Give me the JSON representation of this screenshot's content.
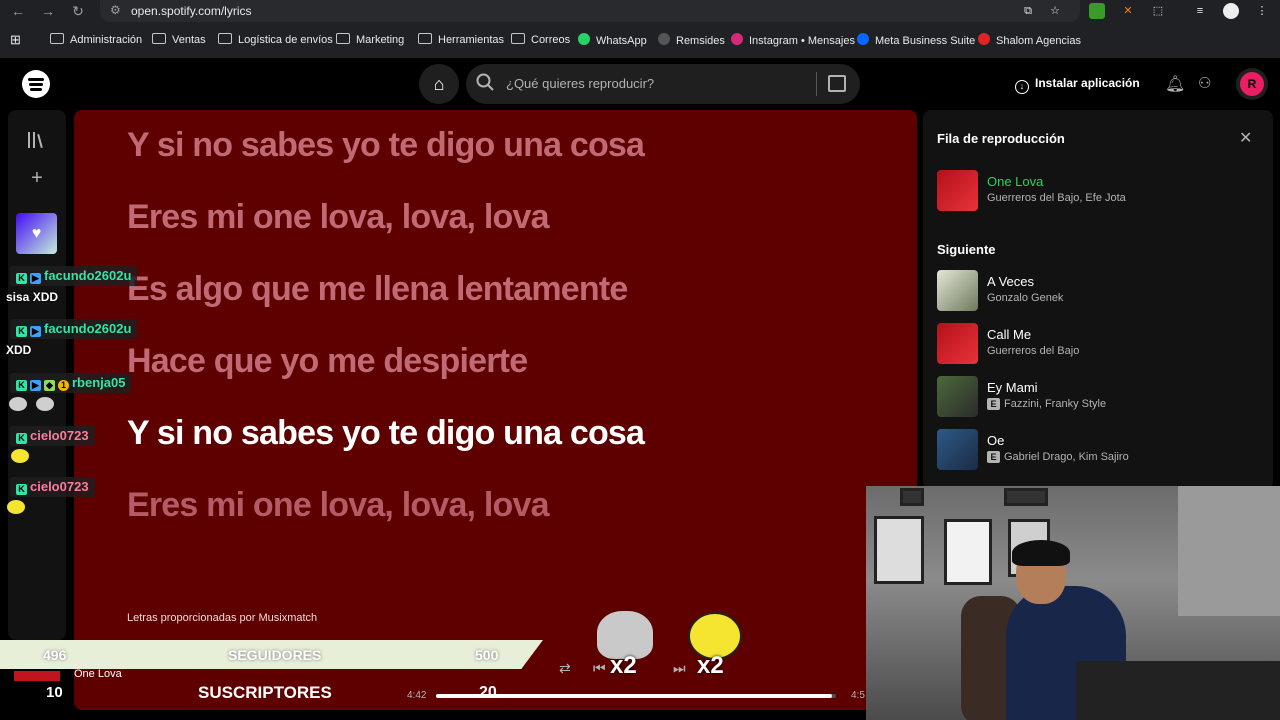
{
  "browser": {
    "url": "open.spotify.com/lyrics",
    "bookmarks": [
      "Administración",
      "Ventas",
      "Logística de envíos",
      "Marketing",
      "Herramientas",
      "Correos",
      "WhatsApp",
      "Remsides",
      "Instagram • Mensajes",
      "Meta Business Suite",
      "Shalom Agencias"
    ]
  },
  "header": {
    "search_placeholder": "¿Qué quieres reproducir?",
    "install_label": "Instalar aplicación",
    "avatar_initial": "R"
  },
  "lyrics": {
    "lines": [
      "Y si no sabes yo te digo una cosa",
      "Eres mi one lova, lova, lova",
      "Es algo que me llena lentamente",
      "Hace que yo me despierte",
      "Y si no sabes yo te digo una cosa",
      "Eres mi one lova, lova, lova"
    ],
    "active_index": 4,
    "credit": "Letras proporcionadas por Musixmatch"
  },
  "queue": {
    "title": "Fila de reproducción",
    "now_playing": {
      "title": "One Lova",
      "artist": "Guerreros del Bajo, Efe Jota"
    },
    "next_label": "Siguiente",
    "next": [
      {
        "title": "A Veces",
        "artist": "Gonzalo Genek",
        "explicit": false
      },
      {
        "title": "Call Me",
        "artist": "Guerreros del Bajo",
        "explicit": false
      },
      {
        "title": "Ey Mami",
        "artist": "Fazzini, Franky Style",
        "explicit": true
      },
      {
        "title": "Oe",
        "artist": "Gabriel Drago, Kim Sajiro",
        "explicit": true
      }
    ],
    "explicit_badge": "E"
  },
  "chat": [
    {
      "user": "facundo2602u",
      "message": "sisa XDD"
    },
    {
      "user": "facundo2602u",
      "message": "XDD"
    },
    {
      "user": "rbenja05",
      "message": ""
    },
    {
      "user": "cielo0723",
      "message": ""
    },
    {
      "user": "cielo0723",
      "message": ""
    }
  ],
  "overlay": {
    "followers_current": "496",
    "followers_label": "SEGUIDORES",
    "followers_goal": "500",
    "subs_current": "10",
    "subs_label": "SUSCRIPTORES",
    "subs_goal": "20",
    "multiplier_1": "x2",
    "multiplier_2": "x2"
  },
  "player": {
    "track_title": "One Lova",
    "elapsed": "4:42",
    "total": "4:5",
    "progress": 0.99
  },
  "colors": {
    "lyrics_bg": "#5f0000",
    "active_lyric": "#ffffff",
    "playing_green": "#1ed760",
    "chat_username": "#2ee6a6"
  }
}
